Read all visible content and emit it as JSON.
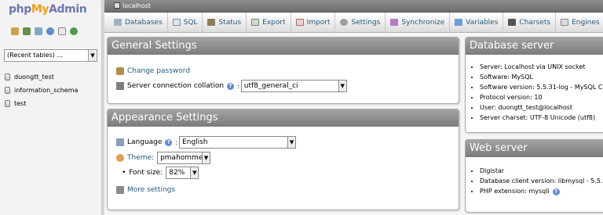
{
  "logo": {
    "part1": "php",
    "part2": "My",
    "part3": "Admin"
  },
  "nav_icons": [
    "home-icon",
    "exit-icon",
    "query-window-icon",
    "docs-icon",
    "sql-docs-icon",
    "reload-icon"
  ],
  "recent_tables": {
    "value": "(Recent tables) ..."
  },
  "databases": [
    "duongtt_test",
    "information_schema",
    "test"
  ],
  "server_bar": {
    "label": "localhost"
  },
  "tabs": [
    {
      "label": "Databases",
      "icon": "databases-icon"
    },
    {
      "label": "SQL",
      "icon": "sql-icon"
    },
    {
      "label": "Status",
      "icon": "status-icon"
    },
    {
      "label": "Export",
      "icon": "export-icon"
    },
    {
      "label": "Import",
      "icon": "import-icon"
    },
    {
      "label": "Settings",
      "icon": "settings-icon"
    },
    {
      "label": "Synchronize",
      "icon": "synchronize-icon"
    },
    {
      "label": "Variables",
      "icon": "variables-icon"
    },
    {
      "label": "Charsets",
      "icon": "charsets-icon"
    },
    {
      "label": "Engines",
      "icon": "engines-icon"
    }
  ],
  "general_settings": {
    "title": "General Settings",
    "change_password": "Change password",
    "collation_label": "Server connection collation",
    "collation_value": "utf8_general_ci"
  },
  "appearance_settings": {
    "title": "Appearance Settings",
    "language_label": "Language",
    "language_value": "English",
    "theme_label": "Theme:",
    "theme_value": "pmahomme",
    "font_size_label": "Font size:",
    "font_size_value": "82%",
    "more_settings": "More settings"
  },
  "database_server": {
    "title": "Database server",
    "items": [
      "Server: Localhost via UNIX socket",
      "Software: MySQL",
      "Software version: 5.5.31-log - MySQL C",
      "Protocol version: 10",
      "User: duongtt_test@localhost",
      "Server charset: UTF-8 Unicode (utf8)"
    ]
  },
  "web_server": {
    "title": "Web server",
    "items": [
      "Digistar",
      "Database client version: libmysql - 5.5.",
      "PHP extension: mysqli"
    ]
  },
  "colors": {
    "link": "#235a81",
    "header_gray": "#8a8a8a",
    "logo_blue": "#6c78af",
    "logo_orange": "#f89c0e"
  }
}
